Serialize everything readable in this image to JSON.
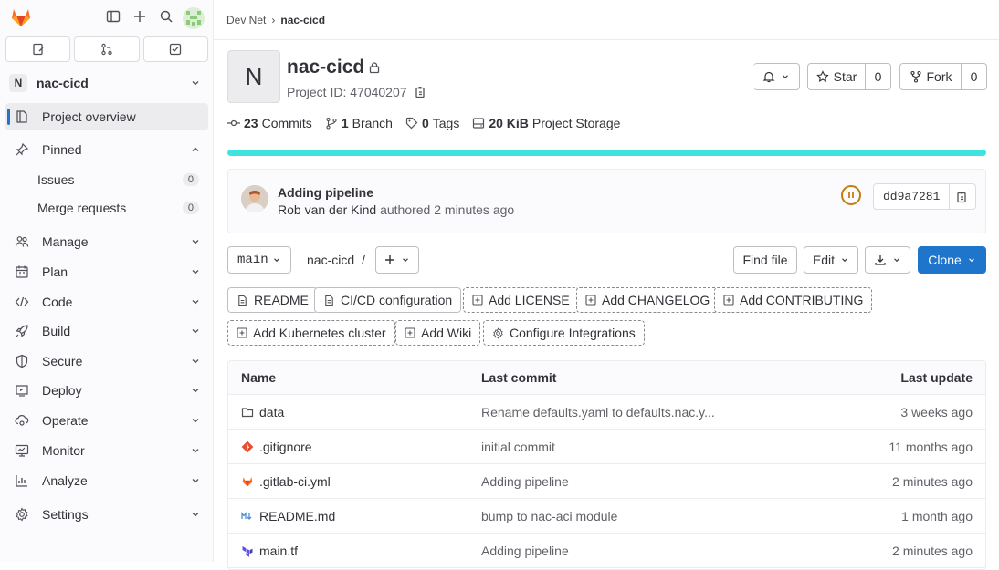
{
  "sidebar": {
    "project_initial": "N",
    "project_name": "nac-cicd",
    "overview_label": "Project overview",
    "pinned_label": "Pinned",
    "pinned_items": [
      {
        "label": "Issues",
        "count": "0"
      },
      {
        "label": "Merge requests",
        "count": "0"
      }
    ],
    "nav": [
      {
        "label": "Manage",
        "icon": "users-icon"
      },
      {
        "label": "Plan",
        "icon": "calendar-icon"
      },
      {
        "label": "Code",
        "icon": "code-icon"
      },
      {
        "label": "Build",
        "icon": "rocket-icon"
      },
      {
        "label": "Secure",
        "icon": "shield-icon"
      },
      {
        "label": "Deploy",
        "icon": "deploy-icon"
      },
      {
        "label": "Operate",
        "icon": "cloud-gear-icon"
      },
      {
        "label": "Monitor",
        "icon": "monitor-icon"
      },
      {
        "label": "Analyze",
        "icon": "chart-icon"
      },
      {
        "label": "Settings",
        "icon": "gear-icon"
      }
    ]
  },
  "breadcrumb": {
    "parent": "Dev Net",
    "current": "nac-cicd"
  },
  "project": {
    "initial": "N",
    "name": "nac-cicd",
    "id_text": "Project ID: 47040207",
    "star_label": "Star",
    "star_count": "0",
    "fork_label": "Fork",
    "fork_count": "0"
  },
  "stats": {
    "commits_num": "23",
    "commits_label": "Commits",
    "branches_num": "1",
    "branches_label": "Branch",
    "tags_num": "0",
    "tags_label": "Tags",
    "storage_num": "20 KiB",
    "storage_label": "Project Storage"
  },
  "progress": {
    "fraction": 1.0,
    "color": "#3ee3e0"
  },
  "commit": {
    "title": "Adding pipeline",
    "author": "Rob van der Kind",
    "meta": "authored 2 minutes ago",
    "sha": "dd9a7281",
    "pipeline_color": "#c17d10"
  },
  "repo": {
    "branch": "main",
    "path": "nac-cicd",
    "path_sep": "/",
    "find_file": "Find file",
    "edit": "Edit",
    "clone": "Clone",
    "clone_color": "#1f75cb"
  },
  "shortcuts": [
    {
      "label": "README",
      "style": "solid",
      "icon": "file-icon"
    },
    {
      "label": "CI/CD configuration",
      "style": "solid",
      "icon": "file-icon"
    },
    {
      "label": "Add LICENSE",
      "style": "dashed",
      "icon": "plus-square-icon"
    },
    {
      "label": "Add CHANGELOG",
      "style": "dashed",
      "icon": "plus-square-icon"
    },
    {
      "label": "Add CONTRIBUTING",
      "style": "dashed",
      "icon": "plus-square-icon"
    },
    {
      "label": "Add Kubernetes cluster",
      "style": "dashed",
      "icon": "plus-square-icon"
    },
    {
      "label": "Add Wiki",
      "style": "dashed",
      "icon": "plus-square-icon"
    },
    {
      "label": "Configure Integrations",
      "style": "dashed",
      "icon": "gear-icon"
    }
  ],
  "files": {
    "headers": {
      "name": "Name",
      "last_commit": "Last commit",
      "last_update": "Last update"
    },
    "rows": [
      {
        "name": "data",
        "icon": "folder-icon",
        "commit": "Rename defaults.yaml to defaults.nac.y...",
        "date": "3 weeks ago"
      },
      {
        "name": ".gitignore",
        "icon": "git-icon",
        "commit": "initial commit",
        "date": "11 months ago"
      },
      {
        "name": ".gitlab-ci.yml",
        "icon": "gitlab-icon",
        "commit": "Adding pipeline",
        "date": "2 minutes ago"
      },
      {
        "name": "README.md",
        "icon": "markdown-icon",
        "commit": "bump to nac-aci module",
        "date": "1 month ago"
      },
      {
        "name": "main.tf",
        "icon": "terraform-icon",
        "commit": "Adding pipeline",
        "date": "2 minutes ago"
      }
    ]
  }
}
